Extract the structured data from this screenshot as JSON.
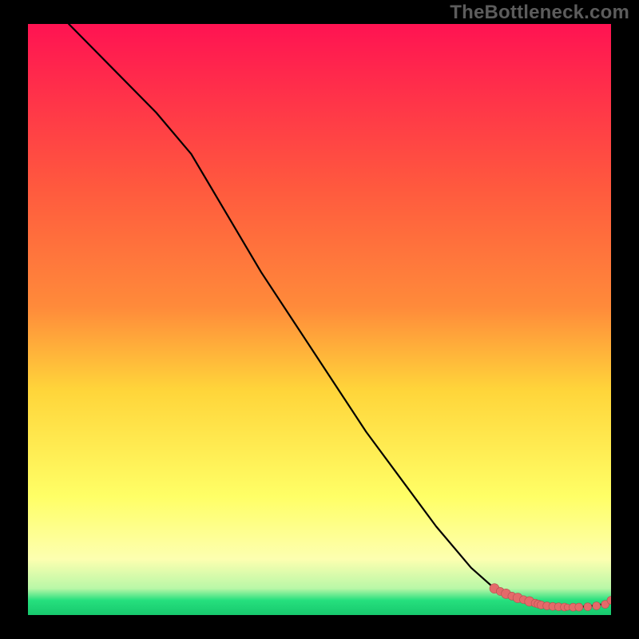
{
  "watermark": "TheBottleneck.com",
  "colors": {
    "gradient_top": "#ff1352",
    "gradient_mid_upper": "#ff8b3a",
    "gradient_mid": "#ffd53a",
    "gradient_mid_lower": "#ffff66",
    "gradient_low": "#fdffb0",
    "gradient_green": "#26e07e",
    "line": "#000000",
    "marker_fill": "#e46a6a",
    "marker_stroke": "#b34f4f"
  },
  "chart_data": {
    "type": "line",
    "title": "",
    "xlabel": "",
    "ylabel": "",
    "xlim": [
      0,
      100
    ],
    "ylim": [
      0,
      100
    ],
    "series": [
      {
        "name": "curve",
        "x": [
          7,
          15,
          22,
          28,
          34,
          40,
          46,
          52,
          58,
          64,
          70,
          76,
          80,
          84,
          87,
          89,
          91,
          93,
          95,
          97,
          99,
          100
        ],
        "y": [
          100,
          92,
          85,
          78,
          68,
          58,
          49,
          40,
          31,
          23,
          15,
          8,
          4.5,
          2.5,
          1.7,
          1.4,
          1.3,
          1.3,
          1.4,
          1.6,
          1.9,
          2.5
        ]
      }
    ],
    "markers": {
      "name": "points",
      "x": [
        80,
        81,
        82,
        83,
        84,
        85,
        86,
        87,
        87.5,
        88,
        89,
        90,
        91,
        92,
        92.5,
        93.5,
        94.5,
        96,
        97.5,
        99,
        100
      ],
      "y": [
        4.5,
        4.0,
        3.6,
        3.2,
        2.9,
        2.6,
        2.3,
        2.0,
        1.85,
        1.7,
        1.55,
        1.45,
        1.4,
        1.35,
        1.33,
        1.32,
        1.34,
        1.4,
        1.55,
        1.8,
        2.5
      ],
      "r": [
        6,
        5,
        6,
        5,
        6,
        5,
        6,
        5,
        5,
        5,
        5,
        5,
        5,
        5,
        4,
        5,
        5,
        5,
        5,
        5,
        5
      ]
    }
  }
}
